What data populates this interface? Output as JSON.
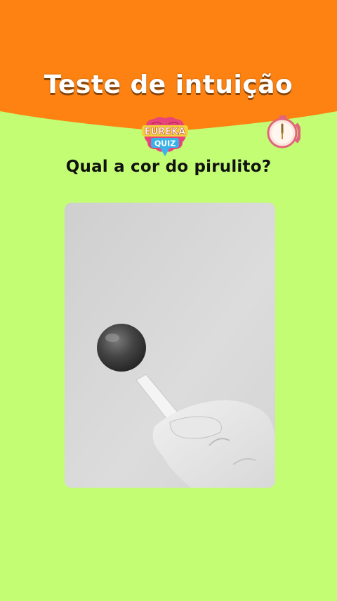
{
  "header": {
    "title": "Teste de intuição",
    "accent_color": "#fd8211",
    "background_color": "#c3fd74"
  },
  "logo": {
    "line1": "EUREKA",
    "line2": "QUIZ",
    "icon": "brain-logo-icon"
  },
  "timer": {
    "icon": "stopwatch-icon"
  },
  "question": {
    "text": "Qual a cor do pirulito?"
  },
  "photo": {
    "icon": "lollipop-photo",
    "tone": "grayscale"
  }
}
